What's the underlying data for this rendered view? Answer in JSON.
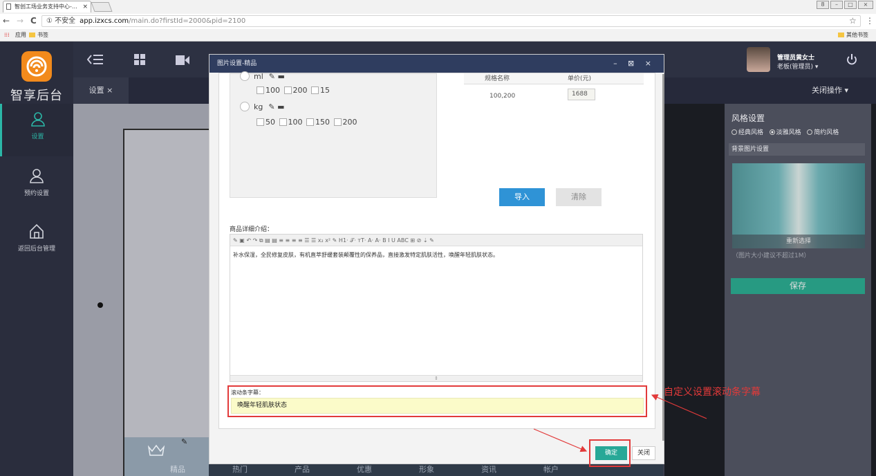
{
  "browser": {
    "tab_title": "智创工场业务支持中心-…",
    "tab_close": "×",
    "nav_back": "←",
    "nav_forward": "→",
    "nav_reload": "C",
    "security": "① 不安全",
    "url_host": "app.izxcs.com",
    "url_path": "/main.do?firstId=2000&pid=2100",
    "star": "☆",
    "menu": "⋮",
    "bookmarks": [
      "应用",
      "书签"
    ],
    "other_bookmarks": "其他书签",
    "win_buttons": [
      "8",
      "–",
      "□",
      "×"
    ]
  },
  "app": {
    "logo_text": "智享后台",
    "sidebar": [
      {
        "label": "设置",
        "icon": "user-icon",
        "active": true
      },
      {
        "label": "预约设置",
        "icon": "user-icon",
        "active": false
      },
      {
        "label": "返回后台管理",
        "icon": "home-icon",
        "active": false
      }
    ],
    "topbar_icons": [
      "menu-collapse-icon",
      "grid-icon",
      "video-icon"
    ],
    "user_name": "管理员黄女士",
    "user_role": "老板(管理员) ▾",
    "power_icon": "power-icon",
    "tab_label": "设置 ×",
    "close_ops": "关闭操作 ▾"
  },
  "phone": {
    "footer_icon": "crown-icon",
    "bottom_nav": [
      "精品",
      "热门",
      "产品",
      "优惠",
      "形象",
      "资讯",
      "帐户"
    ]
  },
  "right_panel": {
    "title": "风格设置",
    "styles": [
      {
        "label": "经典风格",
        "checked": false
      },
      {
        "label": "淡雅风格",
        "checked": true
      },
      {
        "label": "简约风格",
        "checked": false
      }
    ],
    "bg_label": "背景图片设置",
    "reselect": "重新选择",
    "hint": "（图片大小建议不超过1M）",
    "save": "保存"
  },
  "modal": {
    "title": "图片设置-精品",
    "controls": "– ⊠ ×",
    "specs": [
      {
        "name": "ml",
        "options": [
          "100",
          "200",
          "15"
        ]
      },
      {
        "name": "kg",
        "options": [
          "50",
          "100",
          "150",
          "200"
        ]
      }
    ],
    "price_headers": [
      "规格名称",
      "单价(元)"
    ],
    "price_rows": [
      {
        "spec": "100,200",
        "price": "1688"
      }
    ],
    "import_btn": "导入",
    "clear_btn": "清除",
    "detail_label": "商品详细介绍：",
    "toolbar": "✎ ▣ ↶ ↷ ⧉ ▤ ▤ ≡ ≡ ≡ ≡ ☰ ☰ x₂ x² ✎ H1· 𝒯· тT· A· A· B I U ABC ⊞ ⊘ ⇣ ✎",
    "detail_text": "补水保湿，全民修复皮肤，有机直萃舒缓套装颠覆性的保养品，直接激发特定肌肤活性，唤醒年轻肌肤状态。",
    "resize_handle": "⇕",
    "marquee_label": "滚动条字幕：",
    "marquee_value": "唤醒年轻肌肤状态",
    "ok_btn": "确定",
    "close_btn": "关闭"
  },
  "annotation": "自定义设置滚动条字幕",
  "colors": {
    "accent": "#27a897",
    "modal_header": "#2f3d5f",
    "import_button": "#2f93d6",
    "highlight_red": "#e23a3a",
    "sidebar_bg": "#2a2d3d"
  }
}
